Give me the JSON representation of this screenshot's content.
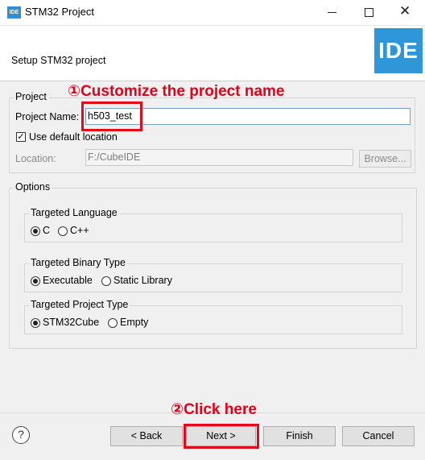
{
  "window": {
    "icon_text": "IDE",
    "title": "STM32 Project",
    "minimize": "—",
    "maximize": "□",
    "close": "✕"
  },
  "header": {
    "description": "Setup STM32 project",
    "logo_text": "IDE"
  },
  "project_group": {
    "title": "Project",
    "name_label": "Project Name:",
    "name_value": "h503_test",
    "use_default_label": "Use default location",
    "use_default_checked": true,
    "location_label": "Location:",
    "location_value": "F:/CubeIDE",
    "browse_label": "Browse..."
  },
  "options": {
    "title": "Options",
    "language": {
      "title": "Targeted Language",
      "options": [
        "C",
        "C++"
      ],
      "selected": "C"
    },
    "binary": {
      "title": "Targeted Binary Type",
      "options": [
        "Executable",
        "Static Library"
      ],
      "selected": "Executable"
    },
    "project_type": {
      "title": "Targeted Project Type",
      "options": [
        "STM32Cube",
        "Empty"
      ],
      "selected": "STM32Cube"
    }
  },
  "annotations": {
    "step1": "①Customize the project name",
    "step2": "②Click here"
  },
  "footer": {
    "help": "?",
    "back": "< Back",
    "next": "Next >",
    "finish": "Finish",
    "cancel": "Cancel"
  },
  "colors": {
    "accent": "#2f97d8",
    "annotation_red": "#e3001b"
  },
  "icons": {
    "help": "help-icon",
    "app": "ide-icon"
  }
}
